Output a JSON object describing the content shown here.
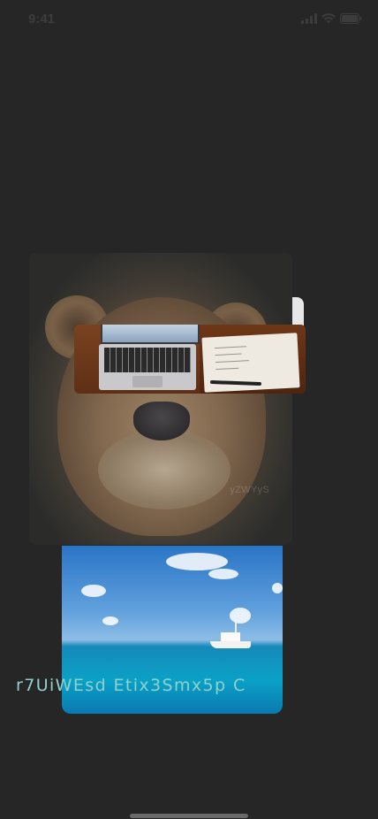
{
  "status_bar": {
    "time": "9:41",
    "icons": [
      "cellular-signal-icon",
      "wifi-icon",
      "battery-icon"
    ]
  },
  "images": {
    "lion": {
      "subject": "lioness-close-up",
      "watermark": "yZWYyS"
    },
    "workspace": {
      "subject": "laptop-and-notebook-on-wooden-desk"
    },
    "sea": {
      "subject": "boat-on-turquoise-sea"
    }
  },
  "caption": "r7UiWEsd Etix3Smx5p C",
  "colors": {
    "background": "#262626",
    "caption": "#8fd1cc",
    "status": "#3c3c3c"
  }
}
